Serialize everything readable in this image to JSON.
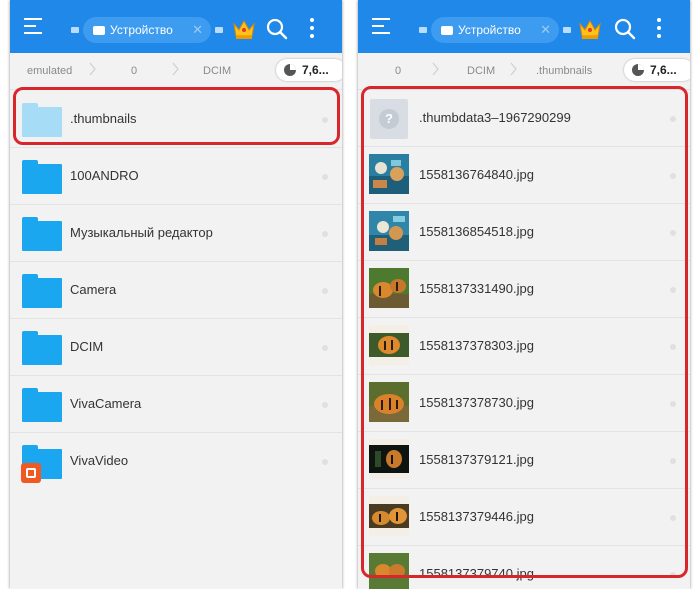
{
  "colors": {
    "topbar": "#1f88e8",
    "folder": "#1ba6f0",
    "highlight": "#d9262c",
    "badge": "#f05a22"
  },
  "left_panel": {
    "tab_label": "Устройство",
    "breadcrumbs": [
      "emulated",
      "0",
      "DCIM"
    ],
    "storage_value": "7,6...",
    "items": [
      {
        "name": ".thumbnails",
        "icon": "folder-icon-light"
      },
      {
        "name": "100ANDRO",
        "icon": "folder-icon"
      },
      {
        "name": "Музыкальный редактор",
        "icon": "folder-icon"
      },
      {
        "name": "Camera",
        "icon": "folder-icon"
      },
      {
        "name": "DCIM",
        "icon": "folder-icon"
      },
      {
        "name": "VivaCamera",
        "icon": "folder-icon"
      },
      {
        "name": "VivaVideo",
        "icon": "folder-app-icon"
      }
    ]
  },
  "right_panel": {
    "tab_label": "Устройство",
    "breadcrumbs": [
      "0",
      "DCIM",
      ".thumbnails"
    ],
    "storage_value": "7,6...",
    "items": [
      {
        "name": ".thumbdata3–1967290299",
        "icon": "unknown-file-icon"
      },
      {
        "name": "1558136764840.jpg",
        "icon": "image-thumbnail"
      },
      {
        "name": "1558136854518.jpg",
        "icon": "image-thumbnail"
      },
      {
        "name": "1558137331490.jpg",
        "icon": "image-thumbnail"
      },
      {
        "name": "1558137378303.jpg",
        "icon": "image-thumbnail"
      },
      {
        "name": "1558137378730.jpg",
        "icon": "image-thumbnail"
      },
      {
        "name": "1558137379121.jpg",
        "icon": "image-thumbnail"
      },
      {
        "name": "1558137379446.jpg",
        "icon": "image-thumbnail"
      },
      {
        "name": "1558137379740.jpg",
        "icon": "image-thumbnail"
      }
    ]
  },
  "icons": {
    "question_mark": "?"
  }
}
